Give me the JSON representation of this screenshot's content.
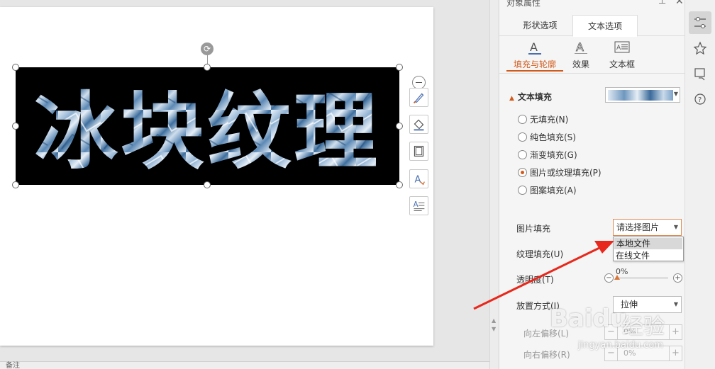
{
  "canvas": {
    "art_text": "冰块纹理",
    "bottom_label": "备注"
  },
  "float_tools": [
    "collapse-icon",
    "brush-icon",
    "fill-bucket-icon",
    "border-icon",
    "text-color-icon",
    "text-layout-icon"
  ],
  "panel": {
    "title": "对象属性",
    "tabs": {
      "shape": "形状选项",
      "text": "文本选项"
    },
    "subtabs": {
      "fill": "填充与轮廓",
      "effect": "效果",
      "box": "文本框"
    },
    "section": {
      "title": "文本填充"
    },
    "radios": [
      {
        "label": "无填充(N)",
        "checked": false
      },
      {
        "label": "纯色填充(S)",
        "checked": false
      },
      {
        "label": "渐变填充(G)",
        "checked": false
      },
      {
        "label": "图片或纹理填充(P)",
        "checked": true
      },
      {
        "label": "图案填充(A)",
        "checked": false
      }
    ],
    "picture_fill": {
      "label": "图片填充",
      "value": "请选择图片",
      "menu": [
        "本地文件",
        "在线文件"
      ]
    },
    "texture_fill": {
      "label": "纹理填充(U)"
    },
    "transparency": {
      "label": "透明度(T)",
      "value": "0%",
      "level": 0
    },
    "placement": {
      "label": "放置方式(I)",
      "value": "拉伸"
    },
    "offset_left": {
      "label": "向左偏移(L)",
      "value": "0%"
    },
    "offset_right": {
      "label": "向右偏移(R)",
      "value": "0%"
    }
  },
  "side_toolbar": [
    "settings-sliders-icon",
    "star-icon",
    "share-icon",
    "help-icon"
  ],
  "watermark": {
    "brand": "Baidu",
    "brand_cn": "经验",
    "url": "jingyan.baidu.com"
  },
  "colors": {
    "accent": "#d15a1b",
    "arrow": "#e8281c",
    "slide_bg": "#ffffff",
    "textbox_bg": "#000000"
  }
}
